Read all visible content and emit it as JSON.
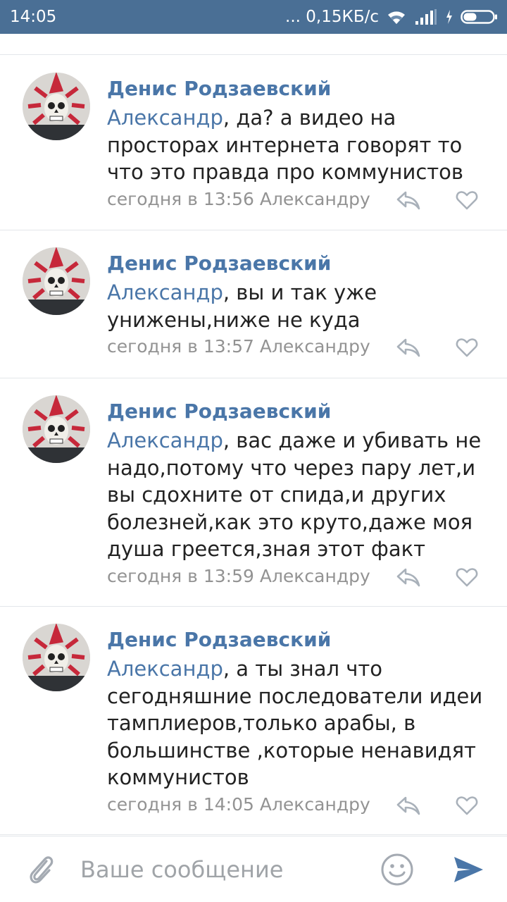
{
  "status_bar": {
    "time": "14:05",
    "network_speed": "... 0,15КБ/с",
    "icons": [
      "wifi-icon",
      "signal-icon",
      "charging-icon",
      "battery-icon"
    ]
  },
  "comments": [
    {
      "author": "Денис Родзаевский",
      "reply_to": "Александр",
      "text": ", да? а видео на просторах интернета говорят то что это правда про коммунистов",
      "meta": "сегодня в 13:56 Александру"
    },
    {
      "author": "Денис Родзаевский",
      "reply_to": "Александр",
      "text": ", вы и так уже унижены,ниже не куда",
      "meta": "сегодня в 13:57 Александру"
    },
    {
      "author": "Денис Родзаевский",
      "reply_to": "Александр",
      "text": ", вас даже и убивать не надо,потому что через пару лет,и вы сдохните от спида,и других болезней,как это круто,даже моя душа греется,зная этот факт",
      "meta": "сегодня в 13:59 Александру"
    },
    {
      "author": "Денис Родзаевский",
      "reply_to": "Александр",
      "text": ", а ты знал что сегодняшние последователи идеи тамплиеров,только арабы, в большинстве ,которые ненавидят коммунистов",
      "meta": "сегодня в 14:05 Александру"
    }
  ],
  "composer": {
    "placeholder": "Ваше сообщение",
    "icons": [
      "paperclip-icon",
      "emoji-icon",
      "send-icon"
    ]
  },
  "colors": {
    "status_bar": "#4a6f95",
    "link": "#4a76a8",
    "meta": "#939393",
    "send": "#4a76a8"
  }
}
